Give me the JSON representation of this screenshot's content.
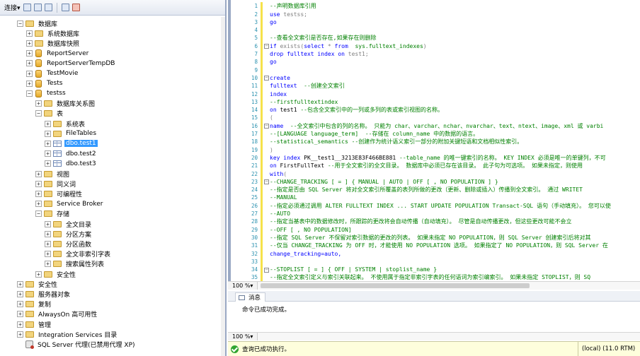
{
  "object_explorer": {
    "toolbar": {
      "connect_label": "连接",
      "connect_arrow": "▾"
    },
    "tree": [
      {
        "label": "数据库",
        "icon": "folder-icon",
        "level": 0,
        "toggle": "−"
      },
      {
        "label": "系统数据库",
        "icon": "folder-icon",
        "level": 1,
        "toggle": "+"
      },
      {
        "label": "数据库快照",
        "icon": "folder-icon",
        "level": 1,
        "toggle": "+"
      },
      {
        "label": "ReportServer",
        "icon": "database-icon",
        "level": 1,
        "toggle": "+"
      },
      {
        "label": "ReportServerTempDB",
        "icon": "database-icon",
        "level": 1,
        "toggle": "+"
      },
      {
        "label": "TestMovie",
        "icon": "database-icon",
        "level": 1,
        "toggle": "+"
      },
      {
        "label": "Tests",
        "icon": "database-icon",
        "level": 1,
        "toggle": "+"
      },
      {
        "label": "testss",
        "icon": "database-icon",
        "level": 1,
        "toggle": "−"
      },
      {
        "label": "数据库关系图",
        "icon": "folder-icon",
        "level": 2,
        "toggle": "+"
      },
      {
        "label": "表",
        "icon": "folder-icon",
        "level": 2,
        "toggle": "−"
      },
      {
        "label": "系统表",
        "icon": "folder-icon",
        "level": 3,
        "toggle": "+"
      },
      {
        "label": "FileTables",
        "icon": "folder-icon",
        "level": 3,
        "toggle": "+"
      },
      {
        "label": "dbo.test1",
        "icon": "table-icon",
        "level": 3,
        "toggle": "+",
        "selected": true
      },
      {
        "label": "dbo.test2",
        "icon": "table-icon",
        "level": 3,
        "toggle": "+"
      },
      {
        "label": "dbo.test3",
        "icon": "table-icon",
        "level": 3,
        "toggle": "+"
      },
      {
        "label": "视图",
        "icon": "folder-icon",
        "level": 2,
        "toggle": "+"
      },
      {
        "label": "同义词",
        "icon": "folder-icon",
        "level": 2,
        "toggle": "+"
      },
      {
        "label": "可编程性",
        "icon": "folder-icon",
        "level": 2,
        "toggle": "+"
      },
      {
        "label": "Service Broker",
        "icon": "folder-icon",
        "level": 2,
        "toggle": "+"
      },
      {
        "label": "存储",
        "icon": "folder-icon",
        "level": 2,
        "toggle": "−"
      },
      {
        "label": "全文目录",
        "icon": "folder-icon",
        "level": 3,
        "toggle": "+"
      },
      {
        "label": "分区方案",
        "icon": "folder-icon",
        "level": 3,
        "toggle": "+"
      },
      {
        "label": "分区函数",
        "icon": "folder-icon",
        "level": 3,
        "toggle": "+"
      },
      {
        "label": "全文非索引字表",
        "icon": "folder-icon",
        "level": 3,
        "toggle": "+"
      },
      {
        "label": "搜索属性列表",
        "icon": "folder-icon",
        "level": 3,
        "toggle": "+"
      },
      {
        "label": "安全性",
        "icon": "folder-icon",
        "level": 2,
        "toggle": "+"
      },
      {
        "label": "安全性",
        "icon": "folder-icon",
        "level": 0,
        "toggle": "+"
      },
      {
        "label": "服务器对象",
        "icon": "folder-icon",
        "level": 0,
        "toggle": "+"
      },
      {
        "label": "复制",
        "icon": "folder-icon",
        "level": 0,
        "toggle": "+"
      },
      {
        "label": "AlwaysOn 高可用性",
        "icon": "folder-icon",
        "level": 0,
        "toggle": "+"
      },
      {
        "label": "管理",
        "icon": "folder-icon",
        "level": 0,
        "toggle": "+"
      },
      {
        "label": "Integration Services 目录",
        "icon": "folder-icon",
        "level": 0,
        "toggle": "+"
      },
      {
        "label": "SQL Server 代理(已禁用代理 XP)",
        "icon": "agent-icon",
        "level": 0,
        "toggle": ""
      }
    ]
  },
  "editor": {
    "lines": [
      {
        "n": "1",
        "fold": "",
        "parts": [
          {
            "t": "--声明数据库引用",
            "c": "com"
          }
        ]
      },
      {
        "n": "2",
        "fold": "",
        "parts": [
          {
            "t": "use ",
            "c": "kw"
          },
          {
            "t": "testss;",
            "c": "gray"
          }
        ]
      },
      {
        "n": "3",
        "fold": "",
        "parts": [
          {
            "t": "go",
            "c": "kw"
          }
        ]
      },
      {
        "n": "4",
        "fold": "",
        "parts": []
      },
      {
        "n": "5",
        "fold": "",
        "parts": [
          {
            "t": "--查看全文索引是否存在,如果存在则删除",
            "c": "com"
          }
        ]
      },
      {
        "n": "6",
        "fold": "−",
        "parts": [
          {
            "t": "if ",
            "c": "kw"
          },
          {
            "t": "exists",
            "c": "gray"
          },
          {
            "t": "(",
            "c": "gray"
          },
          {
            "t": "select",
            "c": "kw"
          },
          {
            "t": " * ",
            "c": "gray"
          },
          {
            "t": "from",
            "c": "kw"
          },
          {
            "t": "  sys.fulltext_indexes",
            "c": "sys"
          },
          {
            "t": ")",
            "c": "gray"
          }
        ]
      },
      {
        "n": "7",
        "fold": "",
        "parts": [
          {
            "t": "drop fulltext index on ",
            "c": "kw"
          },
          {
            "t": "test1;",
            "c": "gray"
          }
        ]
      },
      {
        "n": "8",
        "fold": "",
        "parts": [
          {
            "t": "go",
            "c": "kw"
          }
        ]
      },
      {
        "n": "9",
        "fold": "",
        "parts": []
      },
      {
        "n": "10",
        "fold": "−",
        "parts": [
          {
            "t": "create",
            "c": "kw"
          }
        ]
      },
      {
        "n": "11",
        "fold": "",
        "parts": [
          {
            "t": "fulltext  ",
            "c": "kw"
          },
          {
            "t": "--创建全文索引",
            "c": "com"
          }
        ]
      },
      {
        "n": "12",
        "fold": "",
        "parts": [
          {
            "t": "index",
            "c": "kw"
          }
        ]
      },
      {
        "n": "13",
        "fold": "",
        "parts": [
          {
            "t": "--firstfulltextindex",
            "c": "com"
          }
        ]
      },
      {
        "n": "14",
        "fold": "",
        "parts": [
          {
            "t": "on ",
            "c": "kw"
          },
          {
            "t": "test1 ",
            "c": "plain"
          },
          {
            "t": "--包含全文索引中的一列或多列的表或索引视图的名称。",
            "c": "com"
          }
        ]
      },
      {
        "n": "15",
        "fold": "",
        "parts": [
          {
            "t": "(",
            "c": "gray"
          }
        ]
      },
      {
        "n": "16",
        "fold": "−",
        "parts": [
          {
            "t": "name  ",
            "c": "kw"
          },
          {
            "t": "--全文索引中包含的列的名称。 只能为 char、varchar、nchar、nvarchar、text、ntext、image、xml 或 varbi",
            "c": "com"
          }
        ]
      },
      {
        "n": "17",
        "fold": "",
        "parts": [
          {
            "t": "--[LANGUAGE language_term]  --存储在 column_name 中的数据的语言。",
            "c": "com"
          }
        ]
      },
      {
        "n": "18",
        "fold": "",
        "parts": [
          {
            "t": "--statistical_semantics --创建作为统计语义索引一部分的附加关键短语和文档相似性索引。",
            "c": "com"
          }
        ]
      },
      {
        "n": "19",
        "fold": "",
        "parts": [
          {
            "t": ")",
            "c": "gray"
          }
        ]
      },
      {
        "n": "20",
        "fold": "",
        "parts": [
          {
            "t": "key index ",
            "c": "kw"
          },
          {
            "t": "PK__test1__3213E83F466BE881 ",
            "c": "plain"
          },
          {
            "t": "--table_name 的唯一键索引的名称。 KEY INDEX 必须是唯一的单键列，不可",
            "c": "com"
          }
        ]
      },
      {
        "n": "21",
        "fold": "",
        "parts": [
          {
            "t": "on ",
            "c": "kw"
          },
          {
            "t": "FirstFullText ",
            "c": "plain"
          },
          {
            "t": "--用于全文索引的全文目录。 数据库中必须已存在该目录。 此子句为可选项。 如果未指定，则使用",
            "c": "com"
          }
        ]
      },
      {
        "n": "22",
        "fold": "",
        "parts": [
          {
            "t": "with",
            "c": "kw"
          },
          {
            "t": "(",
            "c": "gray"
          }
        ]
      },
      {
        "n": "23",
        "fold": "−",
        "parts": [
          {
            "t": "--CHANGE_TRACKING [ = ] { MANUAL | AUTO | OFF [ , NO POPULATION ] }",
            "c": "com"
          }
        ]
      },
      {
        "n": "24",
        "fold": "",
        "parts": [
          {
            "t": "--指定是否由 SQL Server 将对全文索引所覆盖的表列所做的更改（更新、删除或插入）传播到全文索引。 通过 WRITET",
            "c": "com"
          }
        ]
      },
      {
        "n": "25",
        "fold": "",
        "parts": [
          {
            "t": "--MANUAL",
            "c": "com"
          }
        ]
      },
      {
        "n": "26",
        "fold": "",
        "parts": [
          {
            "t": "--指定必须通过调用 ALTER FULLTEXT INDEX ... START UPDATE POPULATION Transact-SQL 语句（手动填充）。 您可以使",
            "c": "com"
          }
        ]
      },
      {
        "n": "27",
        "fold": "",
        "parts": [
          {
            "t": "--AUTO",
            "c": "com"
          }
        ]
      },
      {
        "n": "28",
        "fold": "",
        "parts": [
          {
            "t": "--指定当基表中的数据修改时，所跟踪的更改将会自动传播（自动填充）。 尽管是自动传播更改，但这些更改可能不会立",
            "c": "com"
          }
        ]
      },
      {
        "n": "29",
        "fold": "",
        "parts": [
          {
            "t": "--OFF [ , NO POPULATION]",
            "c": "com"
          }
        ]
      },
      {
        "n": "30",
        "fold": "",
        "parts": [
          {
            "t": "--指定 SQL Server 不保留对索引数据的更改的列表。 如果未指定 NO POPULATION，则 SQL Server 创建索引后将对其",
            "c": "com"
          }
        ]
      },
      {
        "n": "31",
        "fold": "",
        "parts": [
          {
            "t": "--仅当 CHANGE_TRACKING 为 OFF 时，才能使用 NO POPULATION 选项。 如果指定了 NO POPULATION，则 SQL Server 在",
            "c": "com"
          }
        ]
      },
      {
        "n": "32",
        "fold": "",
        "parts": [
          {
            "t": "change_tracking=auto,",
            "c": "kw"
          }
        ]
      },
      {
        "n": "33",
        "fold": "",
        "parts": []
      },
      {
        "n": "34",
        "fold": "−",
        "parts": [
          {
            "t": "--STOPLIST [ = ] { OFF | SYSTEM | stoplist_name }",
            "c": "com"
          }
        ]
      },
      {
        "n": "35",
        "fold": "",
        "parts": [
          {
            "t": "--指定全文索引定义与索引关联起来。 不使用属于指定非索引字表的任何语词为索引编索引。 如果未指定 STOPLIST，则 SQ",
            "c": "com"
          }
        ]
      }
    ],
    "zoom": "100 %"
  },
  "messages": {
    "tab_label": "消息",
    "text": "命令已成功完成。",
    "zoom": "100 %"
  },
  "status": {
    "text": "查询已成功执行。",
    "server": "(local) (11.0 RTM)"
  }
}
